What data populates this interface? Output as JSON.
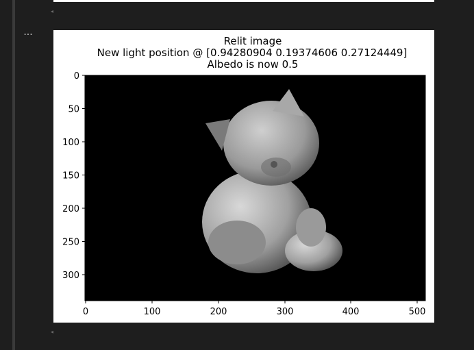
{
  "cell": {
    "collapse_label": "..."
  },
  "figure": {
    "title_lines": [
      "Relit image",
      "New light position @ [0.94280904 0.19374606 0.27124449]",
      "Albedo is now 0.5"
    ],
    "x_ticks": [
      "0",
      "100",
      "200",
      "300",
      "400",
      "500"
    ],
    "y_ticks": [
      "0",
      "50",
      "100",
      "150",
      "200",
      "250",
      "300"
    ],
    "colors": {
      "background": "#000000",
      "figure_bg": "#ffffff"
    }
  }
}
